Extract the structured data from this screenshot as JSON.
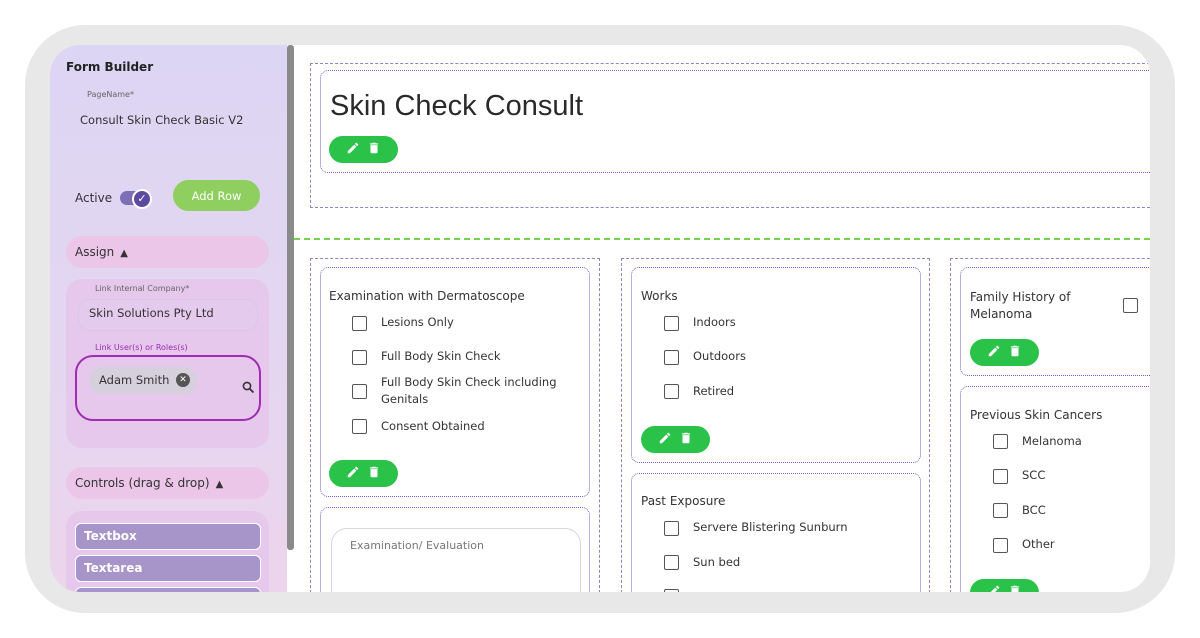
{
  "sidebar": {
    "title": "Form Builder",
    "page_name_label": "PageName*",
    "page_name_value": "Consult Skin Check Basic V2",
    "active_label": "Active",
    "add_row_label": "Add Row",
    "assign_label": "Assign",
    "link_company_label": "Link Internal Company*",
    "link_company_value": "Skin Solutions Pty Ltd",
    "link_users_label": "Link User(s) or Roles(s)",
    "user_chip": "Adam Smith",
    "controls_label": "Controls (drag & drop)",
    "controls": [
      "Textbox",
      "Textarea"
    ]
  },
  "form": {
    "title": "Skin Check Consult",
    "q1": {
      "label": "Examination with Dermatoscope",
      "options": [
        "Lesions Only",
        "Full Body Skin Check",
        "Full Body Skin Check including Genitals",
        "Consent Obtained"
      ]
    },
    "q1_textarea_label": "Examination/ Evaluation",
    "q2": {
      "label": "Works",
      "options": [
        "Indoors",
        "Outdoors",
        "Retired"
      ]
    },
    "q3": {
      "label": "Past Exposure",
      "options": [
        "Servere Blistering Sunburn",
        "Sun bed"
      ]
    },
    "q4": {
      "label": "Family History of Melanoma"
    },
    "q5": {
      "label": "Previous Skin Cancers",
      "options": [
        "Melanoma",
        "SCC",
        "BCC",
        "Other"
      ]
    }
  },
  "colors": {
    "accent_green": "#2bc24a",
    "add_row_green": "#8fcf5f",
    "sidebar_purple": "#dcd5f3",
    "focus_purple": "#a02bb6"
  }
}
